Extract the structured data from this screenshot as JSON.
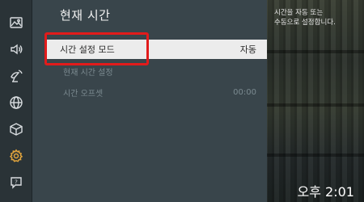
{
  "panel": {
    "title": "현재 시간",
    "items": [
      {
        "label": "시간 설정 모드",
        "value": "자동",
        "state": "selected"
      },
      {
        "label": "현재 시간 설정",
        "value": "",
        "state": "disabled"
      },
      {
        "label": "시간 오프셋",
        "value": "00:00",
        "state": "disabled"
      }
    ]
  },
  "sidebar": {
    "icons": [
      "picture-icon",
      "sound-icon",
      "broadcast-icon",
      "network-icon",
      "system-icon",
      "general-gear-icon",
      "support-icon"
    ],
    "active_icon": "general-gear-icon",
    "accent_color": "#e3a53c"
  },
  "help": {
    "text_line1": "시간을 자동 또는",
    "text_line2": "수동으로 설정합니다."
  },
  "clock": {
    "time": "오후 2:01"
  },
  "highlight_color": "#e21b1b"
}
